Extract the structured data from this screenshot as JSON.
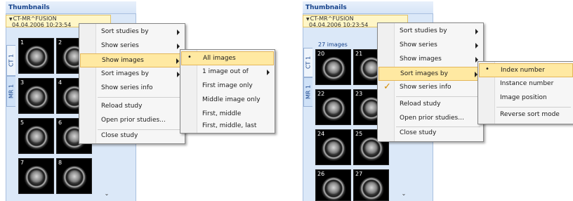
{
  "left": {
    "title": "Thumbnails",
    "study_title": "CT-MR^FUSION",
    "study_date": "04.04.2006 10:23:54",
    "tabs": [
      "CT 1",
      "MR 1"
    ],
    "thumb_numbers": [
      "1",
      "2",
      "3",
      "4",
      "5",
      "6",
      "7",
      "8"
    ],
    "scroll_down": "⌄",
    "context_menu": [
      "Sort studies by",
      "Show series",
      "Show images",
      "Sort images by",
      "Show series info",
      "Reload study",
      "Open prior studies...",
      "Close study"
    ],
    "submenu": [
      "All images",
      "1 image out of",
      "First image only",
      "Middle image only",
      "First, middle",
      "First, middle, last"
    ],
    "selected_mark": "•"
  },
  "right": {
    "title": "Thumbnails",
    "study_title": "CT-MR^FUSION",
    "study_date": "04.04.2006 10:23:54",
    "image_count": "27 images",
    "tabs": [
      "CT 1",
      "MR 1"
    ],
    "thumb_numbers": [
      "20",
      "21",
      "22",
      "23",
      "24",
      "25",
      "26",
      "27"
    ],
    "scroll_down": "⌄",
    "context_menu": [
      "Sort studies by",
      "Show series",
      "Show images",
      "Sort images by",
      "Show series info",
      "Reload study",
      "Open prior studies...",
      "Close study"
    ],
    "check_mark": "✓",
    "submenu": [
      "Index number",
      "Instance number",
      "Image position",
      "Reverse sort mode"
    ],
    "selected_mark": "•"
  }
}
